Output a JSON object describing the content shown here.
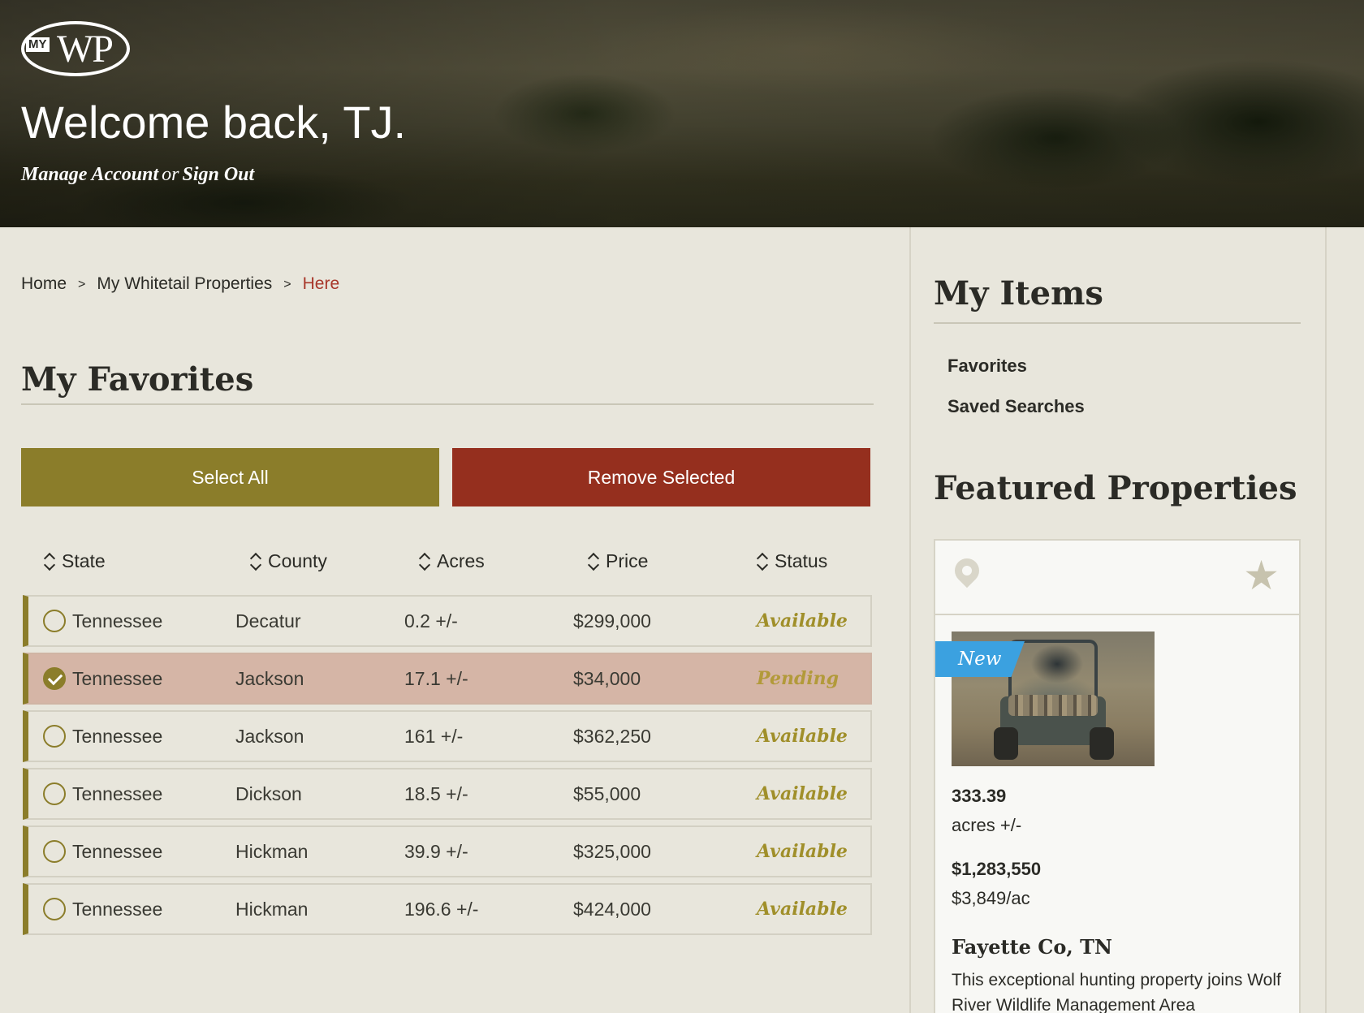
{
  "header": {
    "logo_my": "MY",
    "logo_wp": "WP",
    "welcome": "Welcome back, TJ.",
    "manage_account": "Manage Account",
    "or": "or",
    "sign_out": "Sign Out"
  },
  "breadcrumb": {
    "items": [
      "Home",
      "My Whitetail Properties",
      "Here"
    ],
    "separator": ">"
  },
  "main": {
    "title": "My Favorites",
    "select_all": "Select All",
    "remove_selected": "Remove Selected",
    "columns": [
      "State",
      "County",
      "Acres",
      "Price",
      "Status"
    ],
    "rows": [
      {
        "state": "Tennessee",
        "county": "Decatur",
        "acres": "0.2 +/-",
        "price": "$299,000",
        "status": "Available",
        "selected": false
      },
      {
        "state": "Tennessee",
        "county": "Jackson",
        "acres": "17.1 +/-",
        "price": "$34,000",
        "status": "Pending",
        "selected": true
      },
      {
        "state": "Tennessee",
        "county": "Jackson",
        "acres": "161 +/-",
        "price": "$362,250",
        "status": "Available",
        "selected": false
      },
      {
        "state": "Tennessee",
        "county": "Dickson",
        "acres": "18.5 +/-",
        "price": "$55,000",
        "status": "Available",
        "selected": false
      },
      {
        "state": "Tennessee",
        "county": "Hickman",
        "acres": "39.9 +/-",
        "price": "$325,000",
        "status": "Available",
        "selected": false
      },
      {
        "state": "Tennessee",
        "county": "Hickman",
        "acres": "196.6 +/-",
        "price": "$424,000",
        "status": "Available",
        "selected": false
      }
    ]
  },
  "sidebar": {
    "my_items_title": "My Items",
    "links": [
      "Favorites",
      "Saved Searches"
    ],
    "featured_title": "Featured Properties",
    "card": {
      "badge": "New",
      "acres": "333.39",
      "acres_unit": "acres +/-",
      "price": "$1,283,550",
      "price_per_acre": "$3,849/ac",
      "location": "Fayette Co, TN",
      "description": "This exceptional hunting property joins Wolf River Wildlife Management Area"
    }
  },
  "colors": {
    "olive": "#8b7d2a",
    "red": "#952f1e",
    "breadcrumb_current": "#a8372a",
    "selected_row": "#d5b5a6",
    "badge_blue": "#3ba1e0"
  },
  "icons": [
    "sort-icon",
    "radio-icon",
    "check-icon",
    "map-pin-icon",
    "star-icon"
  ]
}
